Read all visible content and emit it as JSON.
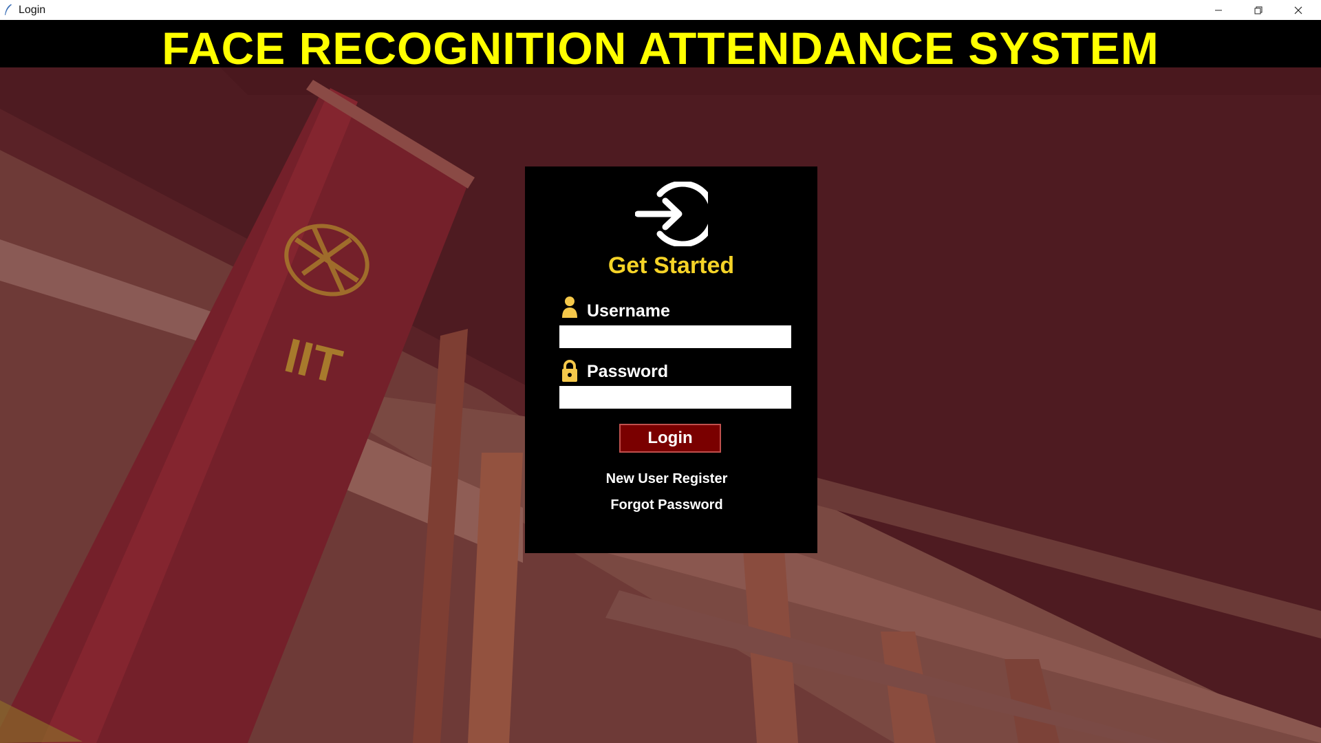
{
  "window": {
    "title": "Login",
    "app_icon": "feather-icon",
    "controls": {
      "minimize": "minimize-icon",
      "maximize": "restore-icon",
      "close": "close-icon"
    }
  },
  "header": {
    "title": "FACE RECOGNITION ATTENDANCE SYSTEM"
  },
  "background": {
    "banner_text": "IIT"
  },
  "login_panel": {
    "heading": "Get Started",
    "icon": "sign-in-icon",
    "username": {
      "label": "Username",
      "icon": "user-icon",
      "value": ""
    },
    "password": {
      "label": "Password",
      "icon": "lock-icon",
      "value": ""
    },
    "login_button": "Login",
    "register_link": "New User Register",
    "forgot_link": "Forgot Password"
  },
  "colors": {
    "header_bg": "#000000",
    "header_text": "#ffff00",
    "heading_text": "#f5d327",
    "button_bg": "#7a0000",
    "background_tint": "#4a1a20"
  }
}
